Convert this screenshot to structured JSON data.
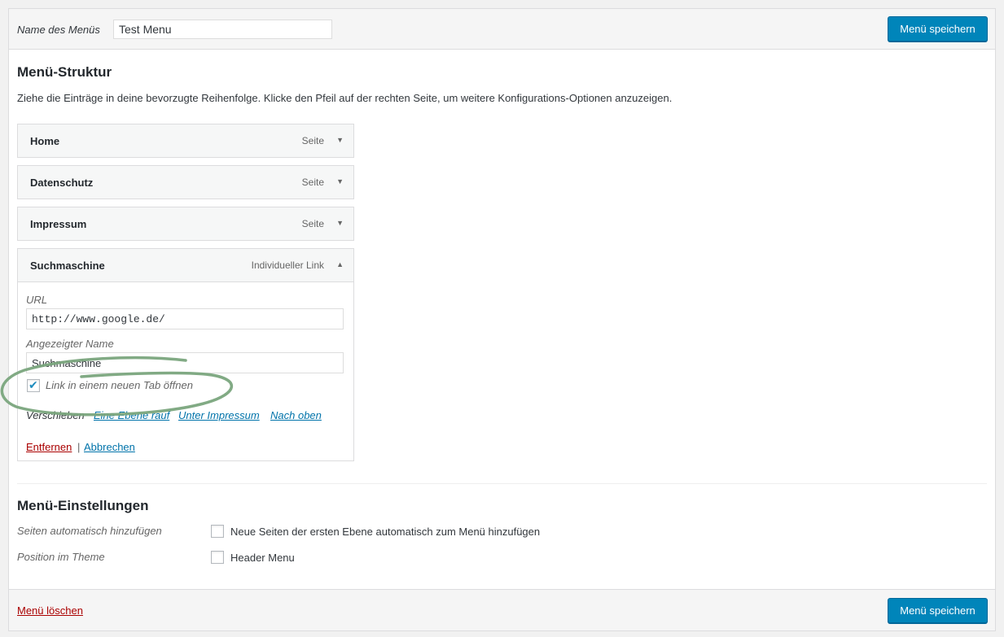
{
  "header": {
    "menu_name_label": "Name des Menüs",
    "menu_name_value": "Test Menu",
    "save_label": "Menü speichern"
  },
  "structure": {
    "title": "Menü-Struktur",
    "instruction": "Ziehe die Einträge in deine bevorzugte Reihenfolge. Klicke den Pfeil auf der rechten Seite, um weitere Konfigurations-Optionen anzuzeigen.",
    "items": [
      {
        "title": "Home",
        "type": "Seite",
        "arrow": "▼"
      },
      {
        "title": "Datenschutz",
        "type": "Seite",
        "arrow": "▼"
      },
      {
        "title": "Impressum",
        "type": "Seite",
        "arrow": "▼"
      },
      {
        "title": "Suchmaschine",
        "type": "Individueller Link",
        "arrow": "▲"
      }
    ],
    "expanded": {
      "url_label": "URL",
      "url_value": "http://www.google.de/",
      "name_label": "Angezeigter Name",
      "name_value": "Suchmaschine",
      "new_tab_label": "Link in einem neuen Tab öffnen",
      "new_tab_checked": true,
      "move_label": "Verschieben",
      "move_links": [
        "Eine Ebene rauf",
        "Unter Impressum",
        "Nach oben"
      ],
      "remove_label": "Entfernen",
      "separator": "|",
      "cancel_label": "Abbrechen"
    }
  },
  "settings": {
    "title": "Menü-Einstellungen",
    "auto_add_label": "Seiten automatisch hinzufügen",
    "auto_add_option": "Neue Seiten der ersten Ebene automatisch zum Menü hinzufügen",
    "position_label": "Position im Theme",
    "position_option": "Header Menu"
  },
  "footer": {
    "delete_label": "Menü löschen",
    "save_label": "Menü speichern"
  },
  "colors": {
    "primary": "#0085ba",
    "link": "#0073aa",
    "danger": "#a00",
    "annotation": "#7aa57d"
  }
}
